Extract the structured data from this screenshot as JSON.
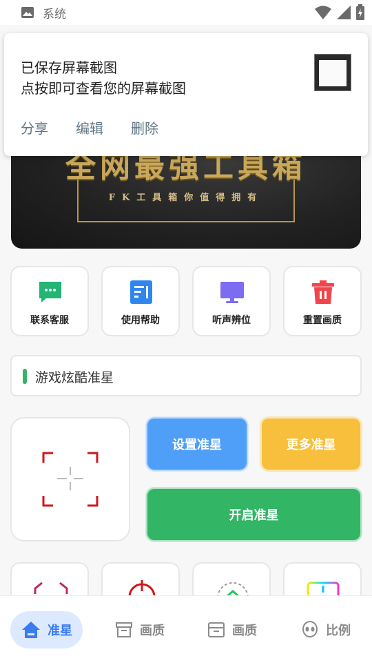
{
  "status_bar": {
    "system_label": "系统"
  },
  "notification": {
    "title": "已保存屏幕截图",
    "subtitle": "点按即可查看您的屏幕截图",
    "actions": [
      "分享",
      "编辑",
      "删除"
    ]
  },
  "banner": {
    "title": "全网最强工具箱",
    "subtitle": "FK工具箱你值得拥有"
  },
  "features": [
    {
      "label": "联系客服",
      "icon": "chat-icon",
      "color": "#22b573"
    },
    {
      "label": "使用帮助",
      "icon": "help-doc-icon",
      "color": "#2f87ee"
    },
    {
      "label": "听声辨位",
      "icon": "monitor-icon",
      "color": "#7b6cf0"
    },
    {
      "label": "重置画质",
      "icon": "trash-icon",
      "color": "#f0454d"
    }
  ],
  "game_field": {
    "value": "游戏炫酷准星"
  },
  "buttons": {
    "set": "设置准星",
    "more": "更多准星",
    "open": "开启准星"
  },
  "bottom_nav": [
    {
      "label": "准星",
      "icon": "home-icon",
      "active": true
    },
    {
      "label": "画质",
      "icon": "archive-icon",
      "active": false
    },
    {
      "label": "画质",
      "icon": "inbox-icon",
      "active": false
    },
    {
      "label": "比例",
      "icon": "alien-icon",
      "active": false
    }
  ],
  "colors": {
    "accent_blue": "#4f9ef8",
    "accent_yellow": "#f7bf3c",
    "accent_green": "#32b565",
    "nav_active": "#3a7cf0"
  }
}
